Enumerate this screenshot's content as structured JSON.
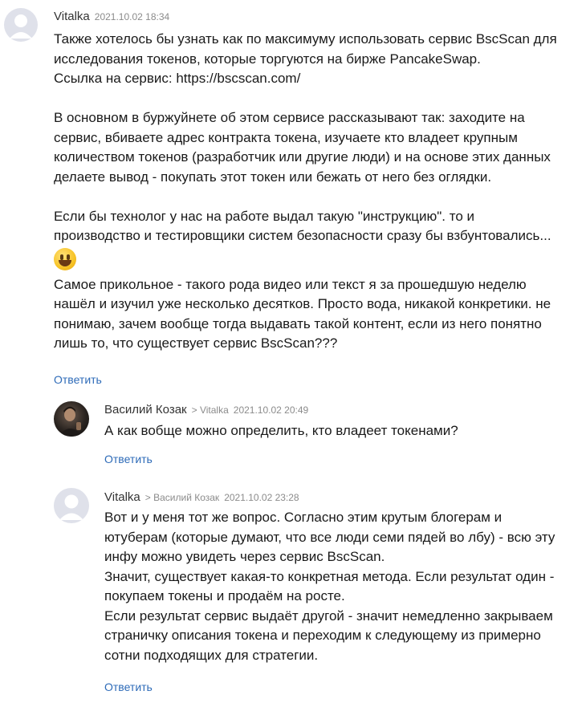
{
  "comments": [
    {
      "author": "Vitalka",
      "reply_to": "",
      "date": "2021.10.02 18:34",
      "avatar_icon": "user-silhouette-icon",
      "paragraphs": [
        [
          "Также хотелось бы узнать как по максимуму использовать сервис BscScan для",
          "исследования токенов, которые торгуются на бирже PancakeSwap.",
          "Ссылка на сервис: https://bscscan.com/"
        ],
        [
          "В основном в буржуйнете об этом сервисе рассказывают так: заходите на",
          "сервис, вбиваете адрес контракта токена, изучаете кто владеет крупным",
          "количеством токенов (разработчик или другие люди) и на основе этих данных",
          "делаете вывод - покупать этот токен или бежать от него без оглядки."
        ],
        [
          "Если бы технолог у нас на работе выдал такую \"инструкцию\". то и",
          "производство и тестировщики систем безопасности сразу бы взбунтовались..."
        ],
        [
          "Самое прикольное - такого рода видео или текст я за прошедшую неделю",
          "нашёл и изучил уже несколько десятков. Просто вода, никакой конкретики. не",
          "понимаю, зачем вообще тогда выдавать такой контент, если из него понятно",
          "лишь то, что существует сервис BscScan???"
        ]
      ],
      "reply_label": "Ответить"
    },
    {
      "author": "Василий Козак",
      "reply_to": "> Vitalka",
      "date": "2021.10.02 20:49",
      "avatar_icon": "user-photo-avatar",
      "paragraphs": [
        [
          "А как вобще можно определить, кто владеет токенами?"
        ]
      ],
      "reply_label": "Ответить"
    },
    {
      "author": "Vitalka",
      "reply_to": "> Василий Козак",
      "date": "2021.10.02 23:28",
      "avatar_icon": "user-silhouette-icon",
      "paragraphs": [
        [
          "Вот и у меня тот же вопрос. Согласно этим крутым блогерам и",
          "ютуберам (которые думают, что все люди семи пядей во лбу) - всю эту",
          "инфу можно увидеть через сервис BscScan.",
          "Значит, существует какая-то конкретная метода. Если результат один -",
          "покупаем токены и продаём на росте.",
          "Если результат сервис выдаёт другой - значит немедленно закрываем",
          "страничку описания токена и переходим к следующему из примерно",
          "сотни подходящих для стратегии."
        ]
      ],
      "reply_label": "Ответить"
    }
  ],
  "colors": {
    "link": "#2e6bb8",
    "meta_gray": "#8b8b8b",
    "avatar_bg": "#dfe1ea",
    "avatar_fg": "#ffffff"
  }
}
